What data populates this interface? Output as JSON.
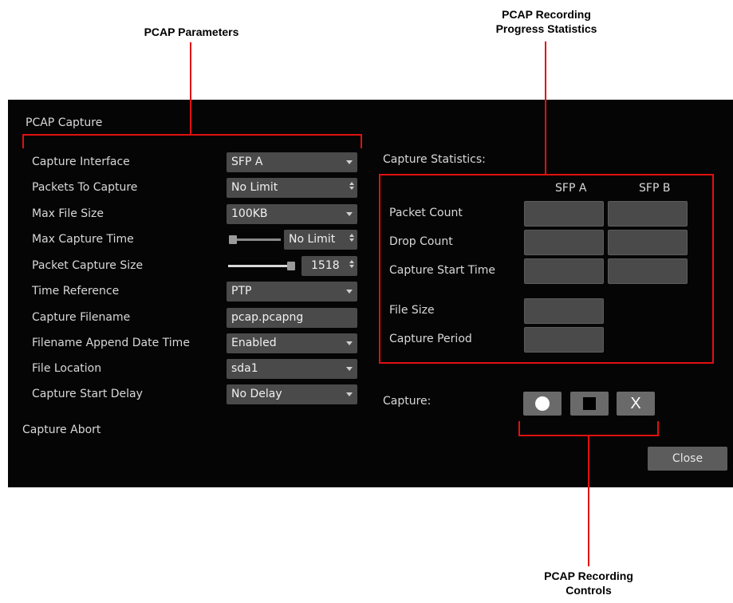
{
  "callouts": {
    "params": "PCAP Parameters",
    "stats_line1": "PCAP Recording",
    "stats_line2": "Progress Statistics",
    "controls_line1": "PCAP Recording",
    "controls_line2": "Controls"
  },
  "dialog": {
    "title": "PCAP Capture",
    "params": [
      {
        "label": "Capture Interface",
        "value": "SFP A"
      },
      {
        "label": "Packets To Capture",
        "value": "No Limit"
      },
      {
        "label": "Max File Size",
        "value": "100KB"
      },
      {
        "label": "Max Capture Time",
        "value": "No Limit"
      },
      {
        "label": "Packet Capture Size",
        "value": "1518"
      },
      {
        "label": "Time Reference",
        "value": "PTP"
      },
      {
        "label": "Capture Filename",
        "value": "pcap.pcapng"
      },
      {
        "label": "Filename Append Date Time",
        "value": "Enabled"
      },
      {
        "label": "File Location",
        "value": "sda1"
      },
      {
        "label": "Capture Start Delay",
        "value": "No Delay"
      }
    ],
    "capture_abort": "Capture Abort",
    "stats": {
      "title": "Capture Statistics:",
      "col_a": "SFP A",
      "col_b": "SFP B",
      "rows": [
        "Packet Count",
        "Drop Count",
        "Capture Start Time",
        "File Size",
        "Capture Period"
      ]
    },
    "capture_label": "Capture:",
    "close_label": "Close",
    "controls": [
      "record-icon",
      "stop-icon",
      "abort-icon"
    ],
    "abort_glyph": "X",
    "sliders": {
      "max_capture_time_fraction": 0.05,
      "packet_capture_size_fraction": 0.95
    },
    "accent_color": "#e01010"
  }
}
